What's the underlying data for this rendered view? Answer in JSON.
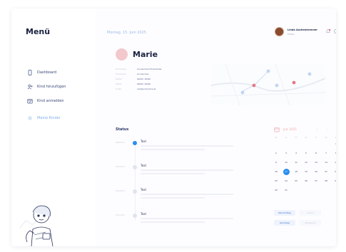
{
  "app": {
    "logo": "Menü"
  },
  "sidebar": {
    "items": [
      {
        "label": "Dashboard",
        "icon": "phone-icon",
        "active": false
      },
      {
        "label": "Kind hinzufügen",
        "icon": "add-user-icon",
        "active": false
      },
      {
        "label": "Kind anmelden",
        "icon": "calendar-check-icon",
        "active": false
      },
      {
        "label": "Meine Kinder",
        "icon": "settings-icon",
        "active": true
      }
    ]
  },
  "header": {
    "date": "Montag, 15. Juni 2025",
    "user": {
      "name": "Linda Aschenbrenner",
      "role": "Mutter"
    }
  },
  "profile": {
    "name": "Marie",
    "fields": [
      {
        "label": "Einrichtung",
        "value": "Grundschule Föhrenstraße"
      },
      {
        "label": "Schulname",
        "value": "Grundschule"
      },
      {
        "label": "Telefon",
        "value": "00000 / 00000"
      },
      {
        "label": "Notfall",
        "value": "00000 / 00000"
      },
      {
        "label": "E-Mail",
        "value": "mail@schulname.de"
      }
    ]
  },
  "timeline": {
    "title": "Status",
    "items": [
      {
        "time": "08:00 Uhr",
        "title": "Text",
        "active": true
      },
      {
        "time": "10:00 Uhr",
        "title": "Text",
        "active": false
      },
      {
        "time": "12:00 Uhr",
        "title": "Text",
        "active": false
      },
      {
        "time": "14:00 Uhr",
        "title": "Text",
        "active": false
      }
    ]
  },
  "calendar": {
    "month": "Juni 2025",
    "weekdays": [
      "Mo",
      "Di",
      "Mi",
      "Do",
      "Fr",
      "Sa",
      "So"
    ],
    "weeks": [
      [
        "",
        "",
        "",
        "",
        "",
        "",
        "1"
      ],
      [
        "2",
        "3",
        "4",
        "5",
        "6",
        "7",
        "8"
      ],
      [
        "9",
        "10",
        "11",
        "12",
        "13",
        "14",
        "15"
      ],
      [
        "16",
        "17",
        "18",
        "19",
        "20",
        "21",
        "22"
      ],
      [
        "23",
        "24",
        "25",
        "26",
        "27",
        "28",
        "29"
      ],
      [
        "30",
        "31",
        "",
        "",
        "",
        "",
        ""
      ]
    ],
    "selected": "17",
    "legend": [
      {
        "label": "Nachmittag",
        "muted": false
      },
      {
        "label": "Ferien",
        "muted": true
      },
      {
        "label": "Ganztags",
        "muted": false
      },
      {
        "label": "Abwesend",
        "muted": true
      }
    ]
  },
  "colors": {
    "accent": "#2a8df0",
    "text": "#1f2a4a",
    "muted": "#c0c7da",
    "brand_pink": "#f2a7ad"
  }
}
